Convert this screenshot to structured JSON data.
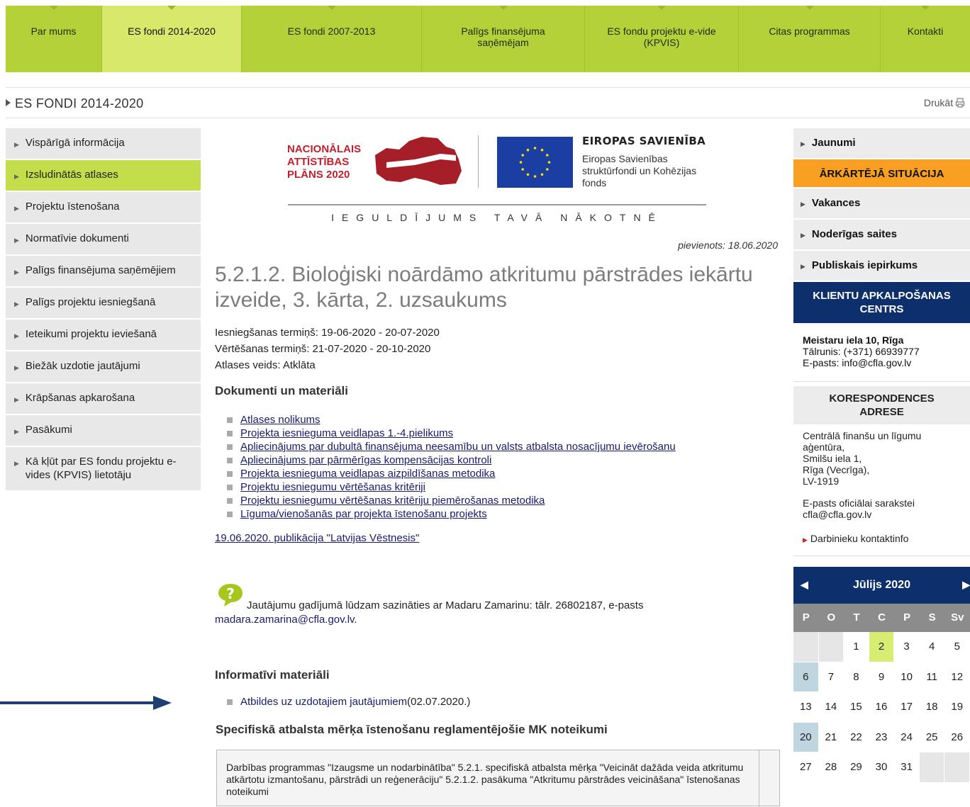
{
  "nav": [
    {
      "label": "Par mums"
    },
    {
      "label": "ES fondi 2014-2020",
      "active": true
    },
    {
      "label": "ES fondi 2007-2013"
    },
    {
      "label": "Palīgs finansējuma saņēmējam"
    },
    {
      "label": "ES fondu projektu e-vide (KPVIS)"
    },
    {
      "label": "Citas programmas"
    },
    {
      "label": "Kontakti"
    }
  ],
  "breadcrumb": "ES FONDI 2014-2020",
  "print_label": "Drukāt",
  "left_menu": [
    {
      "label": "Vispārīgā informācija"
    },
    {
      "label": "Izsludinātās atlases",
      "active": true
    },
    {
      "label": "Projektu īstenošana"
    },
    {
      "label": "Normatīvie dokumenti"
    },
    {
      "label": "Palīgs finansējuma saņēmējiem"
    },
    {
      "label": "Palīgs projektu iesniegšanā"
    },
    {
      "label": "Ieteikumi projektu ieviešanā"
    },
    {
      "label": "Biežāk uzdotie jautājumi"
    },
    {
      "label": "Krāpšanas apkarošana"
    },
    {
      "label": "Pasākumi"
    },
    {
      "label": "Kā kļūt par ES fondu projektu e-vides (KPVIS) lietotāju"
    }
  ],
  "logos": {
    "nap_line1": "NACIONĀLAIS",
    "nap_line2": "ATTĪSTĪBAS",
    "nap_line3": "PLĀNS 2020",
    "eu_title": "EIROPAS SAVIENĪBA",
    "eu_desc": "Eiropas Savienības struktūrfondi un Kohēzijas fonds",
    "invest": "IEGULDĪJUMS TAVĀ NĀKOTNĒ"
  },
  "added": "pievienots: 18.06.2020",
  "title": "5.2.1.2. Bioloģiski noārdāmo atkritumu pārstrādes iekārtu izveide, 3. kārta, 2. uzsaukums",
  "meta": {
    "submission": "Iesniegšanas termiņš: 19-06-2020 - 20-07-2020",
    "evaluation": "Vērtēšanas termiņš: 21-07-2020 - 20-10-2020",
    "type": "Atlases veids: Atklāta"
  },
  "docs_heading": "Dokumenti un materiāli",
  "docs": [
    "Atlases nolikums",
    "Projekta iesnieguma veidlapas 1.-4.pielikums",
    "Apliecinājums par dubultā finansējuma neesamību un valsts atbalsta nosacījumu ievērošanu",
    "Apliecinājums par pārmērīgas kompensācijas kontroli",
    "Projekta iesnieguma veidlapas aizpildīšanas metodika",
    "Projektu iesniegumu vērtēšanas kritēriji",
    "Projektu iesniegumu vērtēšanas kritēriju piemērošanas metodika ",
    "Līguma/vienošanās par projekta īstenošanu projekts"
  ],
  "publication": "19.06.2020. publikācija \"Latvijas Vēstnesis\"",
  "contact_text": "Jautājumu gadījumā lūdzam sazināties ar Madaru Zamarinu: tālr. 26802187, e-pasts ",
  "contact_email": "madara.zamarina@cfla.gov.lv",
  "contact_end": ".",
  "info_heading": "Informatīvi materiāli",
  "info_link": "Atbildes uz uzdotajiem jautājumiem",
  "info_date": " (02.07.2020.)",
  "reg_heading": "Specifiskā atbalsta mērķa īstenošanu reglamentējošie MK noteikumi",
  "reg_text": "Darbības programmas \"Izaugsme un nodarbinātība\" 5.2.1. specifiskā atbalsta mērķa \"Veicināt dažāda veida atkritumu atkārtotu izmantošanu, pārstrādi un reģenerāciju\" 5.2.1.2. pasākuma \"Atkritumu pārstrādes veicināšana\" īstenošanas noteikumi",
  "right": {
    "items_top": [
      "Jaunumi"
    ],
    "emergency": "ĀRKĀRTĒJĀ SITUĀCIJA",
    "items_mid": [
      "Vakances",
      "Noderīgas saites",
      "Publiskais iepirkums"
    ],
    "center_title": "KLIENTU APKALPOŠANAS CENTRS",
    "center_addr": "Meistaru iela 10, Rīga",
    "center_phone": "Tālrunis: (+371) 66939777",
    "center_email": "E-pasts: info@cfla.gov.lv",
    "corr_title": "KORESPONDENCES ADRESE",
    "corr_lines": [
      "Centrālā finanšu un līgumu aģentūra,",
      "Smilšu iela 1,",
      "Rīga (Vecrīga),",
      "LV-1919"
    ],
    "corr_email_label": "E-pasts oficiālai sarakstei",
    "corr_email": "cfla@cfla.gov.lv",
    "staff_link": "Darbinieku kontaktinfo"
  },
  "calendar": {
    "month": "Jūlijs 2020",
    "days": [
      "P",
      "O",
      "T",
      "C",
      "P",
      "S",
      "Sv"
    ],
    "weeks": [
      [
        "",
        "",
        "1",
        "2",
        "3",
        "4",
        "5"
      ],
      [
        "6",
        "7",
        "8",
        "9",
        "10",
        "11",
        "12"
      ],
      [
        "13",
        "14",
        "15",
        "16",
        "17",
        "18",
        "19"
      ],
      [
        "20",
        "21",
        "22",
        "23",
        "24",
        "25",
        "26"
      ],
      [
        "27",
        "28",
        "29",
        "30",
        "31",
        "",
        ""
      ]
    ],
    "highlighted": [
      "2"
    ],
    "marked": [
      "6",
      "20"
    ]
  },
  "colors": {
    "nav_green": "#b4d139",
    "nav_active": "#d7e86b",
    "menu_active": "#c4dd4a",
    "orange": "#f9a023",
    "navy": "#0d2f6b"
  }
}
